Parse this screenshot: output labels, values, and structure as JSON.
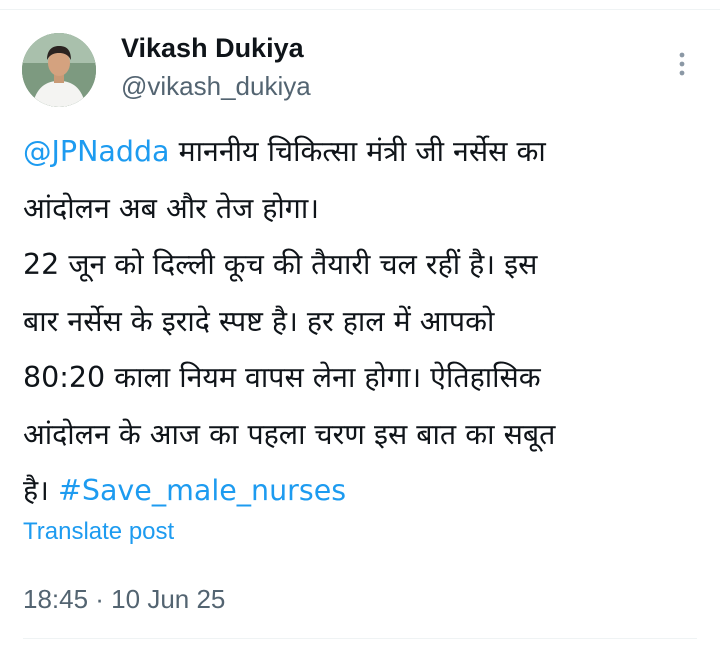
{
  "author": {
    "name": "Vikash Dukiya",
    "handle": "@vikash_dukiya"
  },
  "post": {
    "lines": [
      [
        {
          "text": "@JPNadda",
          "link": true
        },
        {
          "text": " माननीय चिकित्सा मंत्री जी नर्सेस का",
          "link": false
        }
      ],
      [
        {
          "text": "आंदोलन अब और तेज होगा।",
          "link": false
        }
      ],
      [
        {
          "text": "22 जून को दिल्ली कूच की तैयारी चल रहीं है। इस",
          "link": false
        }
      ],
      [
        {
          "text": "बार नर्सेस के इरादे स्पष्ट है। हर हाल में आपको",
          "link": false
        }
      ],
      [
        {
          "text": "80:20 काला नियम वापस लेना होगा। ऐतिहासिक",
          "link": false
        }
      ],
      [
        {
          "text": "आंदोलन के आज का पहला  चरण इस बात का सबूत",
          "link": false
        }
      ],
      [
        {
          "text": "है। ",
          "link": false
        },
        {
          "text": "#Save_male_nurses",
          "link": true
        }
      ]
    ]
  },
  "translate_label": "Translate post",
  "timestamp": "18:45 · 10 Jun 25",
  "icons": {
    "more": "more-vertical-icon",
    "avatar": "profile-photo"
  },
  "colors": {
    "link": "#1d9bf0",
    "text": "#0f1419",
    "secondary": "#536471"
  }
}
